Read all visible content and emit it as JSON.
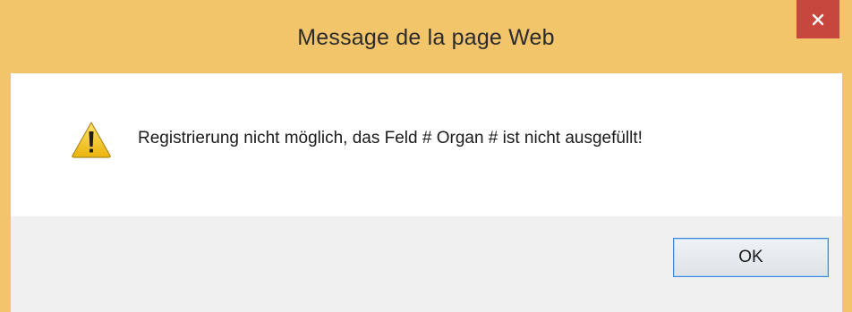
{
  "window": {
    "title": "Message de la page Web",
    "close_icon": "close-icon"
  },
  "dialog": {
    "icon": "warning-icon",
    "message": "Registrierung nicht möglich, das Feld # Organ # ist nicht ausgefüllt!",
    "ok_label": "OK"
  },
  "colors": {
    "frame": "#f3c56b",
    "close_button": "#c7473e",
    "footer": "#f0f0f0",
    "ok_border": "#3c86d8",
    "warning_fill": "#f2c417"
  }
}
